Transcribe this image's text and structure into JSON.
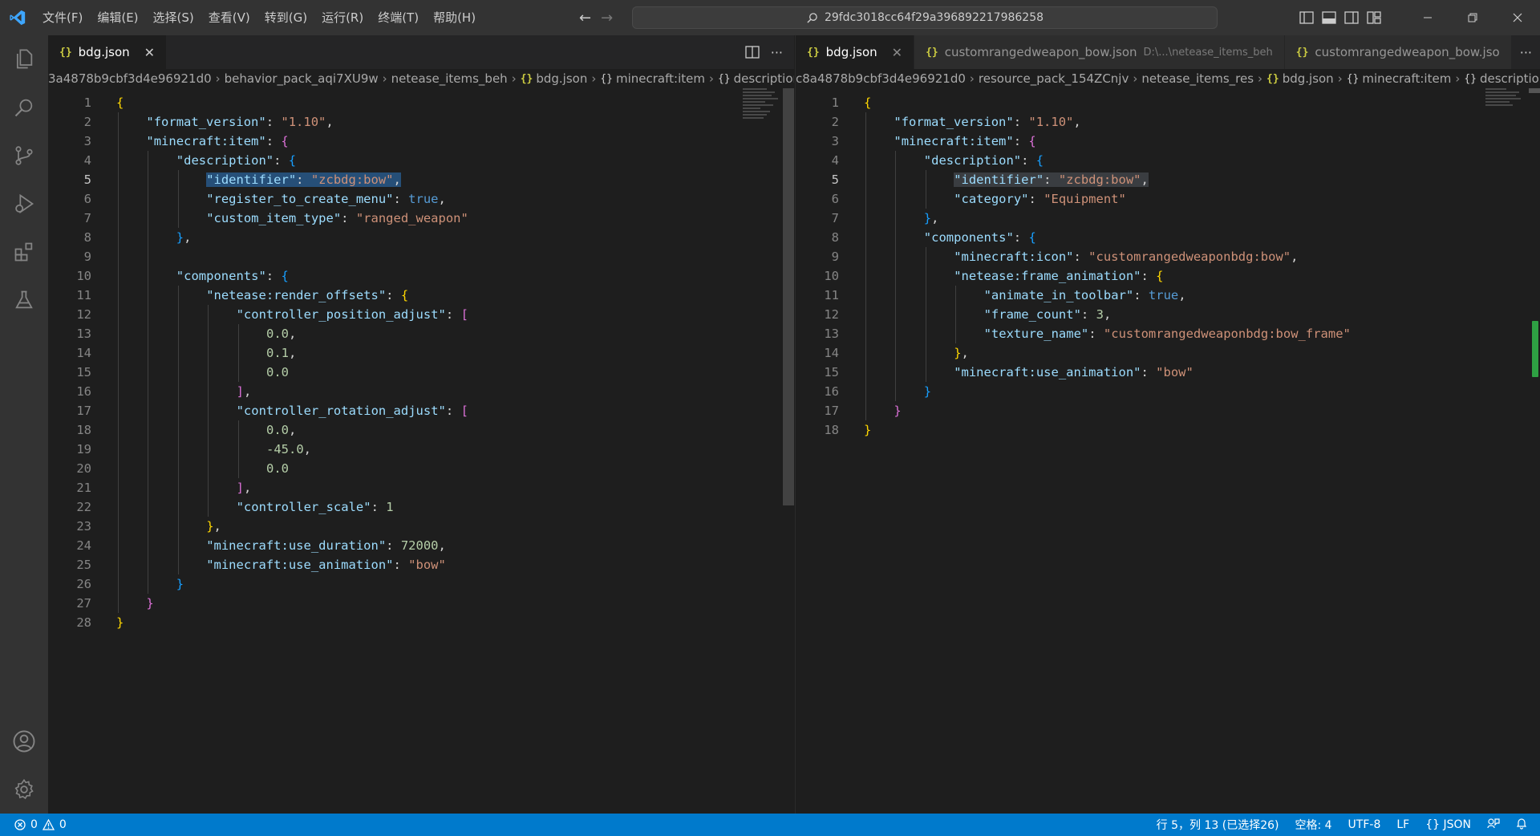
{
  "titlebar": {
    "menu": [
      "文件(F)",
      "编辑(E)",
      "选择(S)",
      "查看(V)",
      "转到(G)",
      "运行(R)",
      "终端(T)",
      "帮助(H)"
    ],
    "search_text": "29fdc3018cc64f29a396892217986258"
  },
  "left_editor": {
    "tabs": [
      {
        "label": "bdg.json",
        "icon": "{}"
      }
    ],
    "breadcrumb": [
      "3a4878b9cbf3d4e96921d0",
      "behavior_pack_aqi7XU9w",
      "netease_items_beh",
      "bdg.json",
      "minecraft:item",
      "description"
    ],
    "line_numbers": [
      "1",
      "2",
      "3",
      "4",
      "5",
      "6",
      "7",
      "8",
      "9",
      "10",
      "11",
      "12",
      "13",
      "14",
      "15",
      "16",
      "17",
      "18",
      "19",
      "20",
      "21",
      "22",
      "23",
      "24",
      "25",
      "26",
      "27",
      "28"
    ],
    "current_line": 5
  },
  "right_editor": {
    "tabs": [
      {
        "label": "bdg.json",
        "icon": "{}"
      },
      {
        "label": "customrangedweapon_bow.json",
        "desc": "D:\\...\\netease_items_beh",
        "icon": "{}"
      },
      {
        "label": "customrangedweapon_bow.jso",
        "icon": "{}"
      }
    ],
    "breadcrumb": [
      "c8a4878b9cbf3d4e96921d0",
      "resource_pack_154ZCnjv",
      "netease_items_res",
      "bdg.json",
      "minecraft:item",
      "description"
    ],
    "line_numbers": [
      "1",
      "2",
      "3",
      "4",
      "5",
      "6",
      "7",
      "8",
      "9",
      "10",
      "11",
      "12",
      "13",
      "14",
      "15",
      "16",
      "17",
      "18"
    ],
    "current_line": 5
  },
  "code_tokens": {
    "format_version_key": "\"format_version\"",
    "format_version_val": "\"1.10\"",
    "minecraft_item": "\"minecraft:item\"",
    "description": "\"description\"",
    "identifier": "\"identifier\"",
    "identifier_val": "\"zcbdg:bow\"",
    "register": "\"register_to_create_menu\"",
    "true": "true",
    "custom_item_type": "\"custom_item_type\"",
    "ranged_weapon": "\"ranged_weapon\"",
    "components": "\"components\"",
    "render_offsets": "\"netease:render_offsets\"",
    "ctrl_pos": "\"controller_position_adjust\"",
    "ctrl_rot": "\"controller_rotation_adjust\"",
    "ctrl_scale": "\"controller_scale\"",
    "n_0_0": "0.0",
    "n_0_1": "0.1",
    "n_m45": "-45.0",
    "n_1": "1",
    "use_duration": "\"minecraft:use_duration\"",
    "n_72000": "72000",
    "use_animation": "\"minecraft:use_animation\"",
    "bow": "\"bow\"",
    "category": "\"category\"",
    "equipment": "\"Equipment\"",
    "icon": "\"minecraft:icon\"",
    "icon_val": "\"customrangedweaponbdg:bow\"",
    "frame_animation": "\"netease:frame_animation\"",
    "animate_in_toolbar": "\"animate_in_toolbar\"",
    "frame_count": "\"frame_count\"",
    "n_3": "3",
    "texture_name": "\"texture_name\"",
    "texture_val": "\"customrangedweaponbdg:bow_frame\""
  },
  "statusbar": {
    "errors": "0",
    "warnings": "0",
    "position": "行 5，列 13 (已选择26)",
    "spaces": "空格: 4",
    "encoding": "UTF-8",
    "eol": "LF",
    "language": "JSON"
  },
  "colors": {
    "accent": "#007acc",
    "key": "#9cdcfe",
    "string": "#ce9178",
    "number": "#b5cea8",
    "keyword": "#569cd6"
  }
}
